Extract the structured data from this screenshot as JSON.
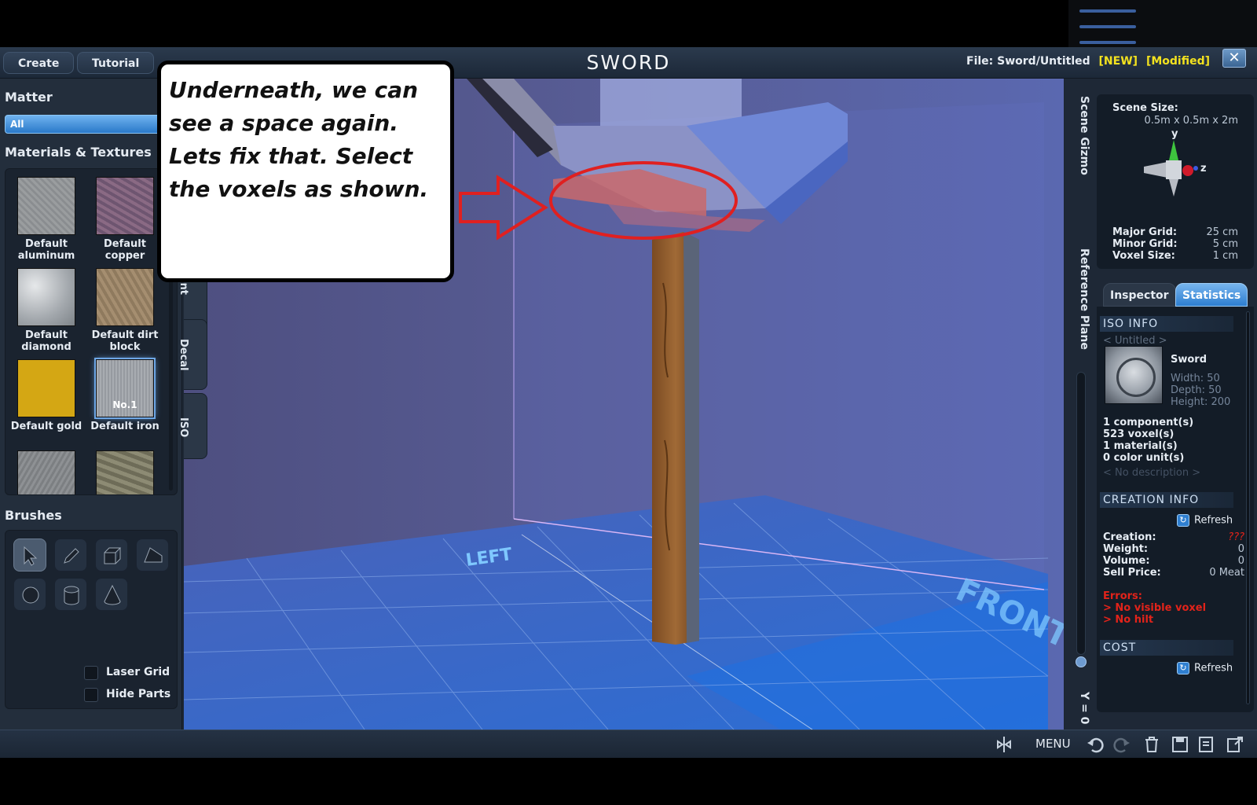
{
  "topbar": {
    "tabs": [
      "Create",
      "Tutorial"
    ],
    "title": "SWORD",
    "file_label": "File:",
    "file_path": "Sword/Untitled",
    "tag_new": "[NEW]",
    "tag_modified": "[Modified]",
    "close_glyph": "✕"
  },
  "left": {
    "matter_title": "Matter",
    "matter_value": "All",
    "materials_title": "Materials & Textures",
    "textures": [
      {
        "label": "Default aluminum",
        "icon": "aluminum-texture"
      },
      {
        "label": "Default copper",
        "icon": "copper-texture"
      },
      {
        "label": "Default diamond",
        "icon": "diamond-texture"
      },
      {
        "label": "Default dirt block",
        "icon": "dirt-texture"
      },
      {
        "label": "Default gold",
        "icon": "gold-texture"
      },
      {
        "label": "Default iron",
        "icon": "iron-texture",
        "badge": "No.1",
        "selected": true
      },
      {
        "label": "",
        "icon": "stone-texture"
      },
      {
        "label": "",
        "icon": "camo-texture"
      }
    ],
    "brushes_title": "Brushes",
    "brushes": [
      "select-brush",
      "pencil-brush",
      "box-brush",
      "wedge-brush",
      "sphere-brush",
      "cylinder-brush",
      "cone-brush"
    ],
    "checkboxes": [
      "Laser Grid",
      "Hide Parts"
    ]
  },
  "mode_tabs": [
    "int",
    "Decal",
    "ISO"
  ],
  "callout": {
    "text": "Underneath, we can see a space again. Lets fix that. Select the voxels as shown."
  },
  "viewport": {
    "label_left": "LEFT",
    "label_front": "FRONT"
  },
  "right": {
    "scene_gizmo_label": "Scene Gizmo",
    "reference_plane_label": "Reference Plane",
    "y_readout": "Y = 0",
    "scene_size_label": "Scene Size:",
    "scene_size_value": "0.5m x 0.5m x 2m",
    "gizmo_axes": {
      "y": "y",
      "z": "z"
    },
    "grid": [
      {
        "label": "Major Grid:",
        "value": "25 cm"
      },
      {
        "label": "Minor Grid:",
        "value": "5 cm"
      },
      {
        "label": "Voxel Size:",
        "value": "1 cm"
      }
    ],
    "tabs": [
      "Inspector",
      "Statistics"
    ],
    "iso_info": {
      "header": "ISO INFO",
      "untitled": "< Untitled >",
      "name": "Sword",
      "width": "Width: 50",
      "depth": "Depth: 50",
      "height": "Height: 200",
      "components": "1 component(s)",
      "voxels": "523 voxel(s)",
      "materials": "1 material(s)",
      "color_units": "0 color unit(s)",
      "description": "< No description >"
    },
    "creation_info": {
      "header": "CREATION INFO",
      "refresh": "Refresh",
      "rows": [
        {
          "label": "Creation:",
          "value": "???"
        },
        {
          "label": "Weight:",
          "value": "0"
        },
        {
          "label": "Volume:",
          "value": "0"
        },
        {
          "label": "Sell Price:",
          "value": "0 Meat"
        }
      ],
      "errors_title": "Errors:",
      "errors": [
        "> No visible voxel",
        "> No hilt"
      ]
    },
    "cost": {
      "header": "COST",
      "refresh": "Refresh"
    }
  },
  "bottombar": {
    "menu_label": "MENU"
  },
  "colors": {
    "accent_blue": "#2d7ed0",
    "tag_yellow": "#f3e21f",
    "error_red": "#e2231a",
    "annotation_red": "#e02020"
  }
}
